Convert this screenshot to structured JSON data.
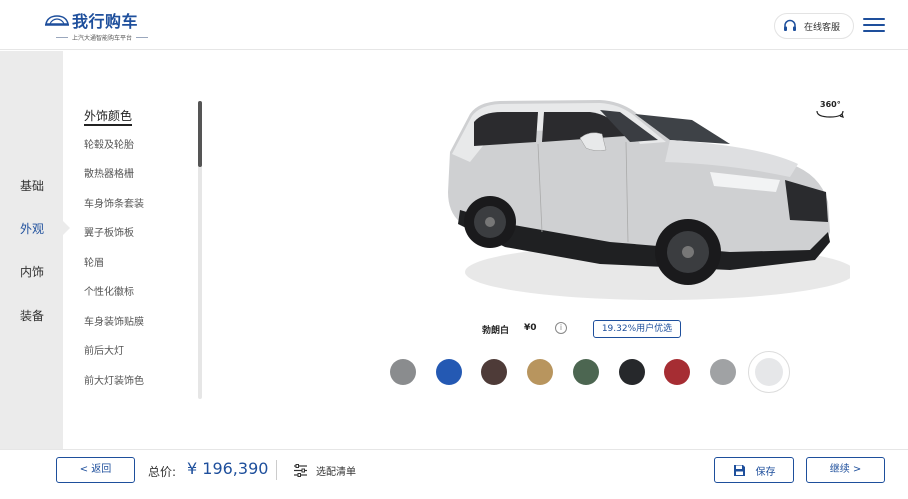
{
  "header": {
    "logo_title": "我行购车",
    "logo_subtitle": "上汽大通智能购车平台",
    "service_label": "在线客服",
    "service_icon": "headset-icon",
    "menu_icon": "hamburger-menu-icon"
  },
  "categories": [
    {
      "label": "基础",
      "active": false
    },
    {
      "label": "外观",
      "active": true
    },
    {
      "label": "内饰",
      "active": false
    },
    {
      "label": "装备",
      "active": false
    }
  ],
  "sub_items": [
    {
      "label": "外饰颜色",
      "active": true
    },
    {
      "label": "轮毂及轮胎",
      "active": false
    },
    {
      "label": "散热器格栅",
      "active": false
    },
    {
      "label": "车身饰条套装",
      "active": false
    },
    {
      "label": "翼子板饰板",
      "active": false
    },
    {
      "label": "轮眉",
      "active": false
    },
    {
      "label": "个性化徽标",
      "active": false
    },
    {
      "label": "车身装饰贴膜",
      "active": false
    },
    {
      "label": "前后大灯",
      "active": false
    },
    {
      "label": "前大灯装饰色",
      "active": false
    }
  ],
  "viewer": {
    "rotate_label": "360°"
  },
  "selected_color": {
    "name": "勃朗白",
    "price": "¥0",
    "info_icon": "info-icon",
    "preference": "19.32%用户优选"
  },
  "colors": [
    {
      "hex": "#8a8c8e"
    },
    {
      "hex": "#2459b3"
    },
    {
      "hex": "#4e3b38"
    },
    {
      "hex": "#b8955e"
    },
    {
      "hex": "#4c6651"
    },
    {
      "hex": "#26282b"
    },
    {
      "hex": "#a62d33"
    },
    {
      "hex": "#a0a2a4"
    },
    {
      "hex": "#e6e7e9",
      "selected": true
    }
  ],
  "footer": {
    "back_label": "< 返回",
    "total_label": "总价:",
    "total_value": "¥ 196,390",
    "config_label": "选配清单",
    "save_label": "保存",
    "next_label": "继续 >"
  },
  "theme": {
    "accent": "#1e4f9c",
    "sidebar_bg": "#ebebeb"
  }
}
